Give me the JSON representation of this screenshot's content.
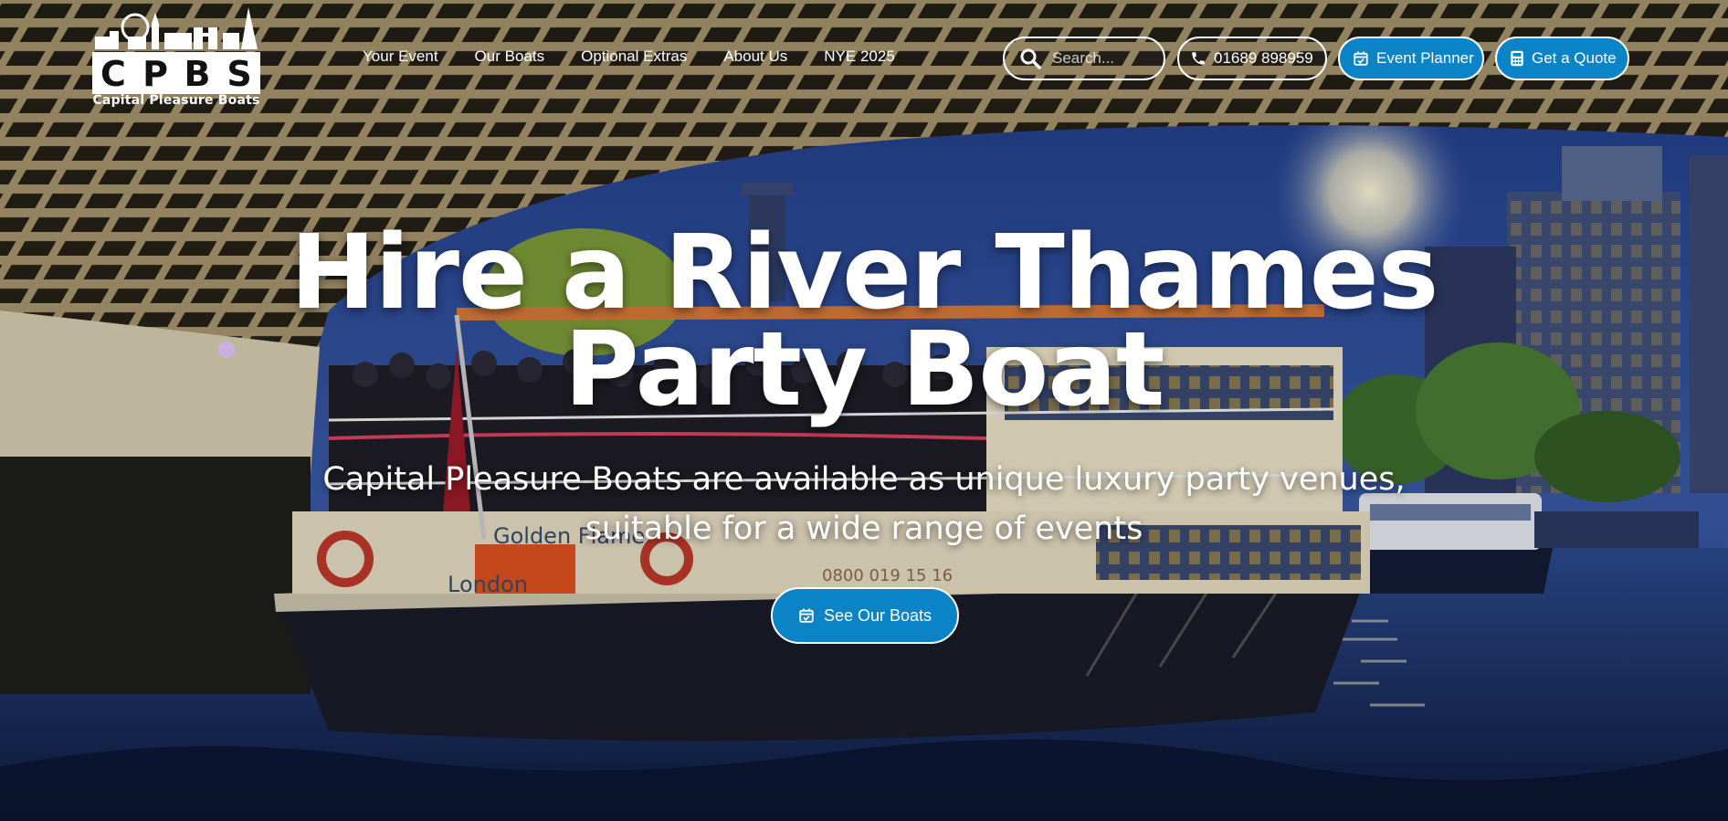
{
  "brand": {
    "logo_letters": [
      "C",
      "P",
      "B",
      "S"
    ],
    "name": "Capital Pleasure Boats",
    "accent": "#0a84c6"
  },
  "nav": {
    "items": [
      {
        "label": "Your Event"
      },
      {
        "label": "Our Boats"
      },
      {
        "label": "Optional Extras"
      },
      {
        "label": "About Us"
      },
      {
        "label": "NYE 2025"
      }
    ]
  },
  "header": {
    "search_placeholder": "Search...",
    "phone_label": "01689 898959",
    "event_planner_label": "Event Planner",
    "quote_label": "Get a Quote",
    "icons": {
      "search": "search-icon",
      "phone": "phone-icon",
      "planner": "calendar-check-icon",
      "quote": "calculator-icon"
    }
  },
  "hero": {
    "headline_line1": "Hire a River Thames",
    "headline_line2": "Party Boat",
    "subtitle_line1": "Capital Pleasure Boats are available as unique luxury party venues,",
    "subtitle_line2": "suitable for a wide range of events",
    "cta_label": "See Our Boats",
    "background": {
      "sky": "#2a4d96",
      "water": "#1c2f63",
      "bridge": "#2e2a22",
      "boat_name": "Golden Flame",
      "boat_home": "London",
      "boat_number": "0800 019 15 16"
    }
  }
}
